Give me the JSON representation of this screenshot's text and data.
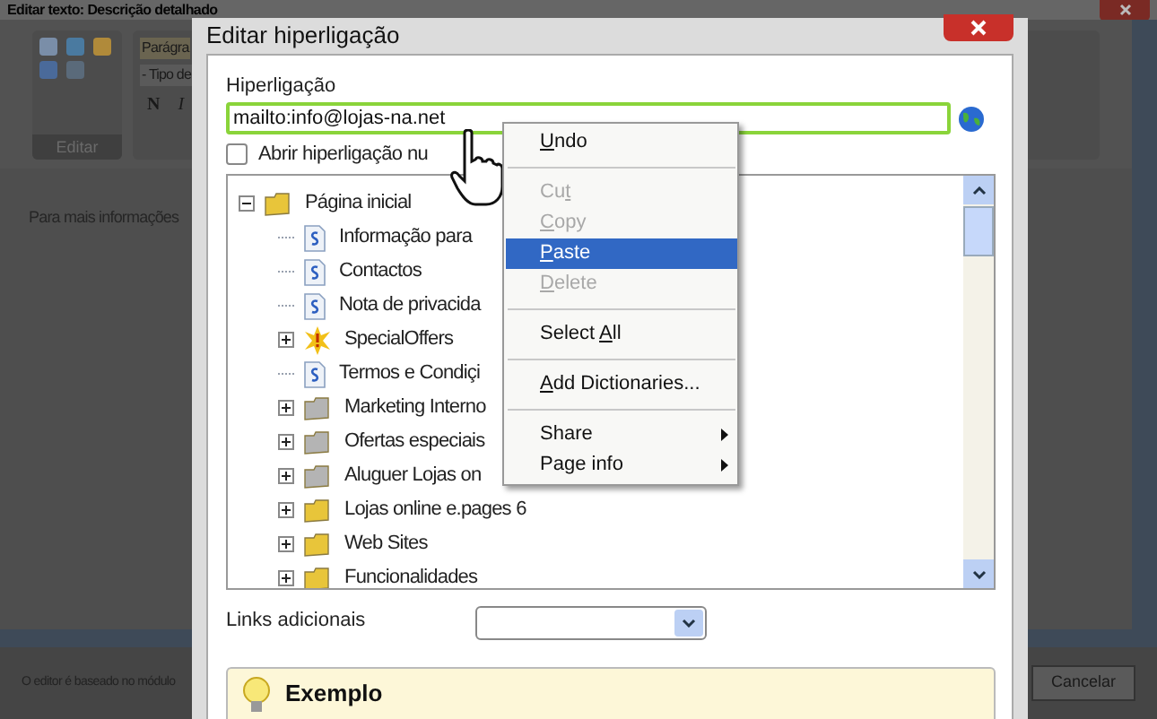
{
  "background_window": {
    "title": "Editar texto: Descrição detalhado",
    "toolbar": {
      "group_label": "Editar",
      "style_select": "Parágra",
      "font_select": "- Tipo de",
      "bold": "N",
      "italic": "I"
    },
    "content": "Para mais informações",
    "footer": "O editor é baseado no módulo",
    "cancel": "Cancelar"
  },
  "dialog": {
    "title": "Editar hiperligação",
    "link_label": "Hiperligação",
    "link_value": "mailto:info@lojas-na.net",
    "new_window": {
      "label": "Abrir hiperligação nu",
      "checked": false
    },
    "tree": [
      {
        "label": "Página inicial",
        "kind": "folder",
        "color": "#e8c53a",
        "expanded": true,
        "children": [
          {
            "label": "Informação para",
            "kind": "page"
          },
          {
            "label": "Contactos",
            "kind": "page"
          },
          {
            "label": "Nota de privacida",
            "kind": "page"
          },
          {
            "label": "SpecialOffers",
            "kind": "special",
            "expanded": false
          },
          {
            "label": "Termos e Condiçi",
            "kind": "page"
          },
          {
            "label": "Marketing Interno",
            "kind": "folder",
            "color": "#b4b4b4",
            "expanded": false
          },
          {
            "label": "Ofertas especiais",
            "kind": "folder",
            "color": "#b4b4b4",
            "expanded": false
          },
          {
            "label": "Aluguer Lojas on",
            "kind": "folder",
            "color": "#b4b4b4",
            "expanded": false
          },
          {
            "label": "Lojas online e.pages 6",
            "kind": "folder",
            "color": "#e8c53a",
            "expanded": false
          },
          {
            "label": "Web Sites",
            "kind": "folder",
            "color": "#e8c53a",
            "expanded": false
          },
          {
            "label": "Funcionalidades",
            "kind": "folder",
            "color": "#e8c53a",
            "expanded": false
          }
        ]
      }
    ],
    "extra_links_label": "Links adicionais",
    "example_title": "Exemplo"
  },
  "context_menu": [
    {
      "kind": "item",
      "mnemonic": "U",
      "after": "ndo",
      "disabled": false,
      "selected": false
    },
    {
      "kind": "separator"
    },
    {
      "kind": "item",
      "before": "Cu",
      "mnemonic": "t",
      "disabled": true,
      "selected": false
    },
    {
      "kind": "item",
      "mnemonic": "C",
      "after": "opy",
      "disabled": true,
      "selected": false
    },
    {
      "kind": "item",
      "mnemonic": "P",
      "after": "aste",
      "disabled": false,
      "selected": true
    },
    {
      "kind": "item",
      "mnemonic": "D",
      "after": "elete",
      "disabled": true,
      "selected": false
    },
    {
      "kind": "separator"
    },
    {
      "kind": "item",
      "before": "Select ",
      "mnemonic": "A",
      "after": "ll",
      "disabled": false,
      "selected": false
    },
    {
      "kind": "separator"
    },
    {
      "kind": "item",
      "mnemonic": "A",
      "after": "dd Dictionaries...",
      "disabled": false,
      "selected": false
    },
    {
      "kind": "separator"
    },
    {
      "kind": "submenu",
      "label": "Share",
      "disabled": false,
      "selected": false
    },
    {
      "kind": "submenu",
      "label": "Page info",
      "disabled": false,
      "selected": false
    }
  ]
}
